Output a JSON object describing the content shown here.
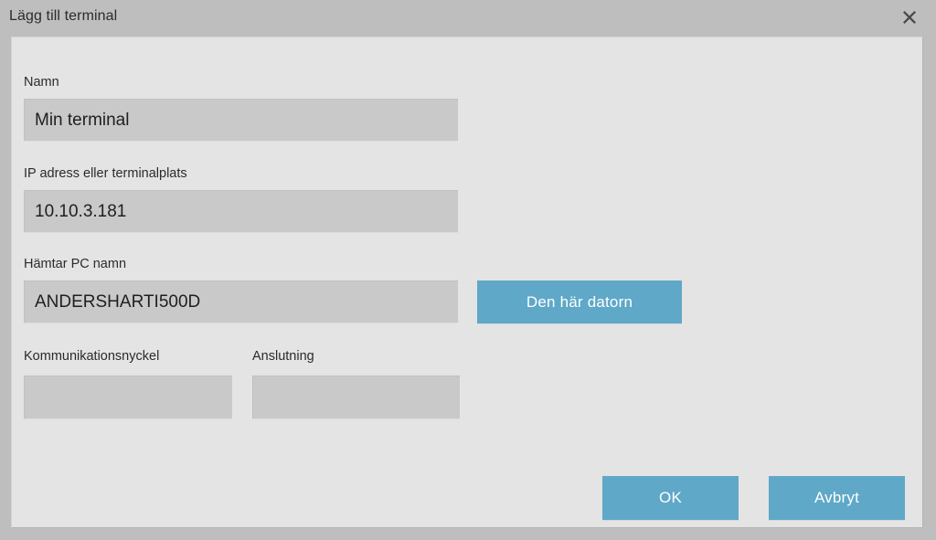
{
  "window": {
    "title": "Lägg till terminal",
    "close_icon": "close-icon"
  },
  "form": {
    "name": {
      "label": "Namn",
      "value": "Min terminal",
      "placeholder": ""
    },
    "ip_address": {
      "label": "IP adress eller terminalplats",
      "value": "10.10.3.181",
      "placeholder": ""
    },
    "pc_name": {
      "label": "Hämtar PC namn",
      "value": "ANDERSHARTI500D",
      "placeholder": "",
      "button_label": "Den här datorn"
    },
    "communication_key": {
      "label": "Kommunikationsnyckel",
      "value": "",
      "placeholder": ""
    },
    "connection": {
      "label": "Anslutning",
      "value": "",
      "placeholder": ""
    }
  },
  "actions": {
    "ok_label": "OK",
    "cancel_label": "Avbryt"
  },
  "colors": {
    "titlebar_bg": "#bebebe",
    "body_bg": "#e4e4e4",
    "input_bg": "#c9c9c9",
    "accent_button": "#5fa8c8",
    "text": "#2b2b2b"
  }
}
